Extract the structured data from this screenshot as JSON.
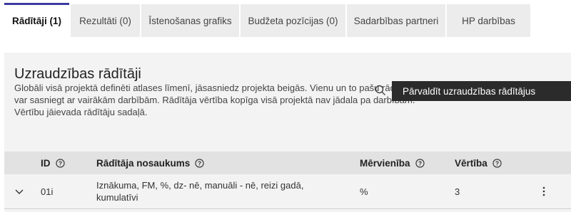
{
  "tabs": [
    {
      "label": "Rādītāji (1)",
      "active": true
    },
    {
      "label": "Rezultāti (0)",
      "active": false
    },
    {
      "label": "Īstenošanas grafiks",
      "active": false
    },
    {
      "label": "Budžeta pozīcijas (0)",
      "active": false
    },
    {
      "label": "Sadarbības partneri",
      "active": false
    },
    {
      "label": "HP darbības",
      "active": false
    }
  ],
  "section": {
    "title": "Uzraudzības rādītāji",
    "description": "Globāli visā projektā definēti atlases līmenī, jāsasniedz projekta beigās. Vienu un to pašu rādītāju var sasniegt ar vairākām darbībām. Rādītāja vērtība kopīga visā projektā nav jādala pa darbībām. Vērtību jāievada rādītāju sadaļā."
  },
  "toolbar": {
    "search_icon": "search-icon",
    "manage_label": "Pārvaldīt uzraudzības rādītājus"
  },
  "table": {
    "headers": {
      "id": "ID",
      "name": "Rādītāja nosaukums",
      "unit": "Mērvienība",
      "value": "Vērtība"
    },
    "rows": [
      {
        "id": "01i",
        "name": "Iznākuma, FM, %, dz- nē, manuāli - nē, reizi gadā, kumulatīvi",
        "unit": "%",
        "value": "3"
      }
    ]
  },
  "colors": {
    "active_tab_border": "#3b3b9e",
    "manage_button_bg": "#2b2b2b",
    "panel_bg": "#f3f3f3",
    "header_bg": "#e2e2e2"
  }
}
